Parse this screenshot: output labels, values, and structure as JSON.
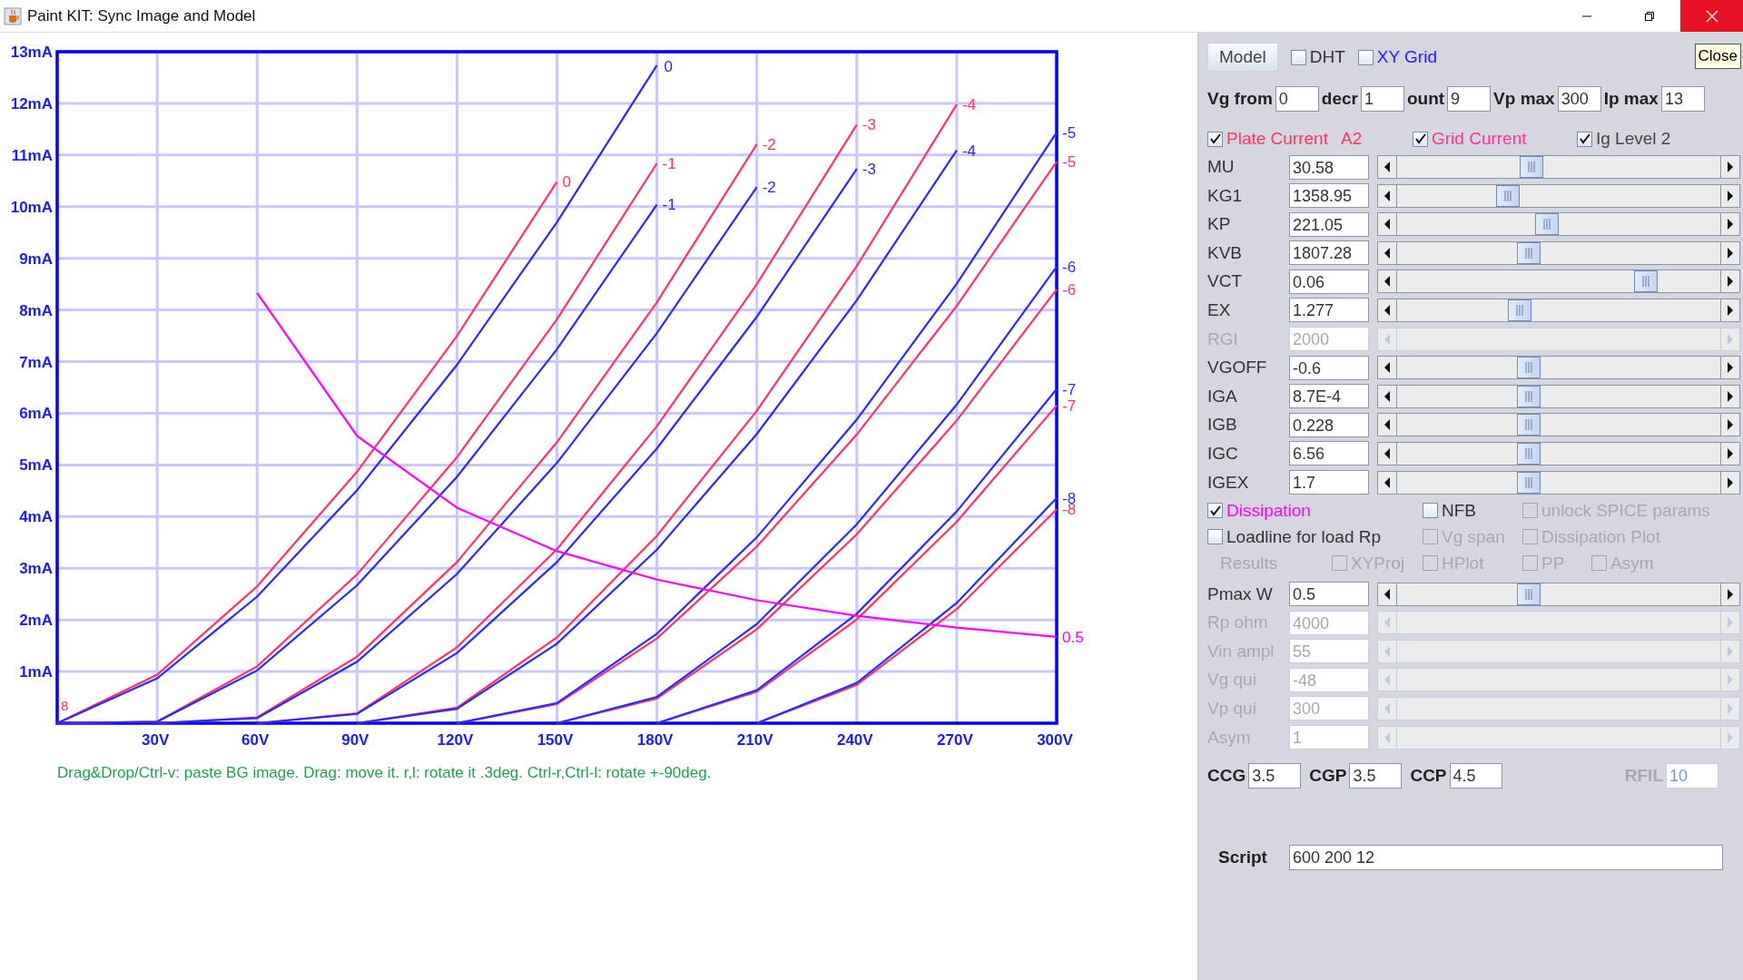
{
  "window": {
    "title": "Paint KIT: Sync Image and Model"
  },
  "plot": {
    "chart_data": {
      "type": "line",
      "x": [
        0,
        30,
        60,
        90,
        120,
        150,
        180,
        210,
        240,
        270,
        300
      ],
      "xlim": [
        0,
        300
      ],
      "ylim": [
        0,
        13
      ],
      "xticks": [
        {
          "value": 30,
          "label": "30V"
        },
        {
          "value": 60,
          "label": "60V"
        },
        {
          "value": 90,
          "label": "90V"
        },
        {
          "value": 120,
          "label": "120V"
        },
        {
          "value": 150,
          "label": "150V"
        },
        {
          "value": 180,
          "label": "180V"
        },
        {
          "value": 210,
          "label": "210V"
        },
        {
          "value": 240,
          "label": "240V"
        },
        {
          "value": 270,
          "label": "270V"
        },
        {
          "value": 300,
          "label": "300V"
        }
      ],
      "yticks": [
        {
          "value": 1,
          "label": "1mA"
        },
        {
          "value": 2,
          "label": "2mA"
        },
        {
          "value": 3,
          "label": "3mA"
        },
        {
          "value": 4,
          "label": "4mA"
        },
        {
          "value": 5,
          "label": "5mA"
        },
        {
          "value": 6,
          "label": "6mA"
        },
        {
          "value": 7,
          "label": "7mA"
        },
        {
          "value": 8,
          "label": "8mA"
        },
        {
          "value": 9,
          "label": "9mA"
        },
        {
          "value": 10,
          "label": "10mA"
        },
        {
          "value": 11,
          "label": "11mA"
        },
        {
          "value": 12,
          "label": "12mA"
        },
        {
          "value": 13,
          "label": "13mA"
        }
      ],
      "series": [
        {
          "name": "0",
          "color": "#ff3366",
          "values": [
            0,
            0.94,
            2.65,
            4.87,
            7.5,
            10.48,
            null,
            null,
            null,
            null,
            null
          ]
        },
        {
          "name": "0",
          "color": "#2a2aff",
          "values": [
            0,
            0.87,
            2.45,
            4.51,
            6.94,
            9.7,
            12.74,
            null,
            null,
            null,
            null
          ]
        },
        {
          "name": "-1",
          "color": "#ff3366",
          "values": [
            0,
            0.03,
            1.1,
            2.88,
            5.15,
            7.82,
            10.84,
            null,
            null,
            null,
            null
          ]
        },
        {
          "name": "-1",
          "color": "#2a2aff",
          "values": [
            0,
            0.03,
            1.02,
            2.67,
            4.77,
            7.24,
            10.04,
            null,
            null,
            null,
            null
          ]
        },
        {
          "name": "-2",
          "color": "#ff3366",
          "values": [
            null,
            0,
            0.11,
            1.29,
            3.12,
            5.44,
            8.15,
            11.21,
            null,
            null,
            null
          ]
        },
        {
          "name": "-2",
          "color": "#2a2aff",
          "values": [
            null,
            0,
            0.1,
            1.19,
            2.89,
            5.04,
            7.55,
            10.38,
            null,
            null,
            null
          ]
        },
        {
          "name": "-3",
          "color": "#ff3366",
          "values": [
            null,
            null,
            0,
            0.19,
            1.47,
            3.37,
            5.75,
            8.5,
            11.59,
            null,
            null
          ]
        },
        {
          "name": "-3",
          "color": "#2a2aff",
          "values": [
            null,
            null,
            0,
            0.18,
            1.36,
            3.12,
            5.32,
            7.87,
            10.73,
            null,
            null
          ]
        },
        {
          "name": "-4",
          "color": "#ff3366",
          "values": [
            null,
            null,
            null,
            0,
            0.3,
            1.66,
            3.63,
            6.05,
            8.85,
            11.98,
            null
          ]
        },
        {
          "name": "-4",
          "color": "#2a2aff",
          "values": [
            null,
            null,
            null,
            0,
            0.28,
            1.54,
            3.36,
            5.6,
            8.19,
            11.09,
            null
          ]
        },
        {
          "name": "-5",
          "color": "#ff3366",
          "values": [
            null,
            null,
            null,
            null,
            0,
            0.37,
            1.64,
            3.42,
            5.59,
            8.08,
            10.87
          ]
        },
        {
          "name": "-5",
          "color": "#2a2aff",
          "values": [
            null,
            null,
            null,
            null,
            0,
            0.39,
            1.73,
            3.6,
            5.88,
            8.51,
            11.44
          ]
        },
        {
          "name": "-6",
          "color": "#ff3366",
          "values": [
            null,
            null,
            null,
            null,
            null,
            0,
            0.48,
            1.82,
            3.66,
            5.86,
            8.4
          ]
        },
        {
          "name": "-6",
          "color": "#2a2aff",
          "values": [
            null,
            null,
            null,
            null,
            null,
            0,
            0.51,
            1.92,
            3.85,
            6.17,
            8.84
          ]
        },
        {
          "name": "-7",
          "color": "#ff3366",
          "values": [
            null,
            null,
            null,
            null,
            null,
            null,
            0,
            0.61,
            2.01,
            3.9,
            6.15
          ]
        },
        {
          "name": "-7",
          "color": "#2a2aff",
          "values": [
            null,
            null,
            null,
            null,
            null,
            null,
            0,
            0.64,
            2.12,
            4.1,
            6.47
          ]
        },
        {
          "name": "-8",
          "color": "#ff3366",
          "values": [
            null,
            null,
            null,
            null,
            null,
            null,
            null,
            0,
            0.74,
            2.21,
            4.14
          ]
        },
        {
          "name": "-8",
          "color": "#2a2aff",
          "values": [
            null,
            null,
            null,
            null,
            null,
            null,
            null,
            0,
            0.78,
            2.33,
            4.36
          ]
        },
        {
          "name": "0.5",
          "color": "#ff00ff",
          "values": [
            null,
            null,
            8.33,
            5.56,
            4.17,
            3.33,
            2.78,
            2.38,
            2.08,
            1.85,
            1.67
          ]
        }
      ],
      "grid": true,
      "annotations": [
        "8"
      ]
    },
    "status_text": "Drag&Drop/Ctrl-v: paste BG image. Drag: move it. r,l: rotate it .3deg. Ctrl-r,Ctrl-l: rotate +-90deg."
  },
  "panel": {
    "model_button": "Model",
    "tooltip": "Close",
    "top_checks": [
      {
        "label": "DHT",
        "checked": false,
        "color": "#333333"
      },
      {
        "label": "XY Grid",
        "checked": false,
        "color": "#2020ff"
      }
    ],
    "range_fields": [
      {
        "label": "Vg from",
        "value": "0"
      },
      {
        "label": "decr",
        "value": "1"
      },
      {
        "label": "ount",
        "value": "9"
      },
      {
        "label": "Vp max",
        "value": "300"
      },
      {
        "label": "Ip max",
        "value": "13"
      }
    ],
    "curve_checks": [
      {
        "label": "Plate Current",
        "checked": true,
        "color": "#ff3366",
        "note": "A2"
      },
      {
        "label": "Grid Current",
        "checked": true,
        "color": "#ff3399"
      },
      {
        "label": "Ig Level 2",
        "checked": true,
        "color": "#444444"
      }
    ],
    "sliders": [
      {
        "label": "MU",
        "value": "30.58",
        "disabled": false,
        "level": 0.41
      },
      {
        "label": "KG1",
        "value": "1358.95",
        "disabled": false,
        "level": 0.33
      },
      {
        "label": "KP",
        "value": "221.05",
        "disabled": false,
        "level": 0.46
      },
      {
        "label": "KVB",
        "value": "1807.28",
        "disabled": false,
        "level": 0.4
      },
      {
        "label": "VCT",
        "value": "0.06",
        "disabled": false,
        "level": 0.79
      },
      {
        "label": "EX",
        "value": "1.277",
        "disabled": false,
        "level": 0.37
      },
      {
        "label": "RGI",
        "value": "2000",
        "disabled": true
      },
      {
        "label": "VGOFF",
        "value": "-0.6",
        "disabled": false,
        "level": 0.4
      },
      {
        "label": "IGA",
        "value": "8.7E-4",
        "disabled": false,
        "level": 0.4
      },
      {
        "label": "IGB",
        "value": "0.228",
        "disabled": false,
        "level": 0.4
      },
      {
        "label": "IGC",
        "value": "6.56",
        "disabled": false,
        "level": 0.4
      },
      {
        "label": "IGEX",
        "value": "1.7",
        "disabled": false,
        "level": 0.4
      }
    ],
    "options": [
      {
        "items": [
          {
            "kind": "checkbox",
            "label": "Dissipation",
            "checked": true,
            "disabled": false,
            "color": "#ff00ff"
          },
          {
            "kind": "checkbox",
            "label": "NFB",
            "checked": false,
            "disabled": false,
            "color": "#333333"
          },
          {
            "kind": "checkbox",
            "label": "unlock SPICE params",
            "checked": false,
            "disabled": true,
            "color": "#a6a8b0"
          }
        ]
      },
      {
        "items": [
          {
            "kind": "checkbox",
            "label": "Loadline for load Rp",
            "checked": false,
            "disabled": false,
            "color": "#333333"
          },
          {
            "kind": "checkbox",
            "label": "Vg span",
            "checked": false,
            "disabled": true,
            "color": "#a6a8b0"
          },
          {
            "kind": "checkbox",
            "label": "Dissipation Plot",
            "checked": false,
            "disabled": true,
            "color": "#a6a8b0"
          }
        ]
      },
      {
        "items": [
          {
            "kind": "label",
            "label": "Results",
            "color": "#a6a8b0"
          },
          {
            "kind": "checkbox",
            "label": "XYProj",
            "checked": false,
            "disabled": true,
            "color": "#a6a8b0"
          },
          {
            "kind": "checkbox",
            "label": "HPlot",
            "checked": false,
            "disabled": true,
            "color": "#a6a8b0"
          },
          {
            "kind": "checkbox",
            "label": "PP",
            "checked": false,
            "disabled": true,
            "color": "#a6a8b0"
          },
          {
            "kind": "checkbox",
            "label": "Asym",
            "checked": false,
            "disabled": true,
            "color": "#a6a8b0"
          }
        ]
      }
    ],
    "load_sliders": [
      {
        "label": "Pmax W",
        "value": "0.5",
        "disabled": false,
        "level": 0.4
      },
      {
        "label": "Rp ohm",
        "value": "4000",
        "disabled": true
      },
      {
        "label": "Vin ampl",
        "value": "55",
        "disabled": true
      },
      {
        "label": "Vg qui",
        "value": "-48",
        "disabled": true
      },
      {
        "label": "Vp qui",
        "value": "300",
        "disabled": true
      },
      {
        "label": "Asym",
        "value": "1",
        "disabled": true
      }
    ],
    "coupling_fields": [
      {
        "label": "CCG",
        "value": "3.5",
        "disabled": false
      },
      {
        "label": "CGP",
        "value": "3.5",
        "disabled": false
      },
      {
        "label": "CCP",
        "value": "4.5",
        "disabled": false
      },
      {
        "label": "RFIL",
        "value": "10",
        "disabled": true
      }
    ],
    "script": {
      "label": "Script",
      "value": "600 200 12"
    }
  }
}
